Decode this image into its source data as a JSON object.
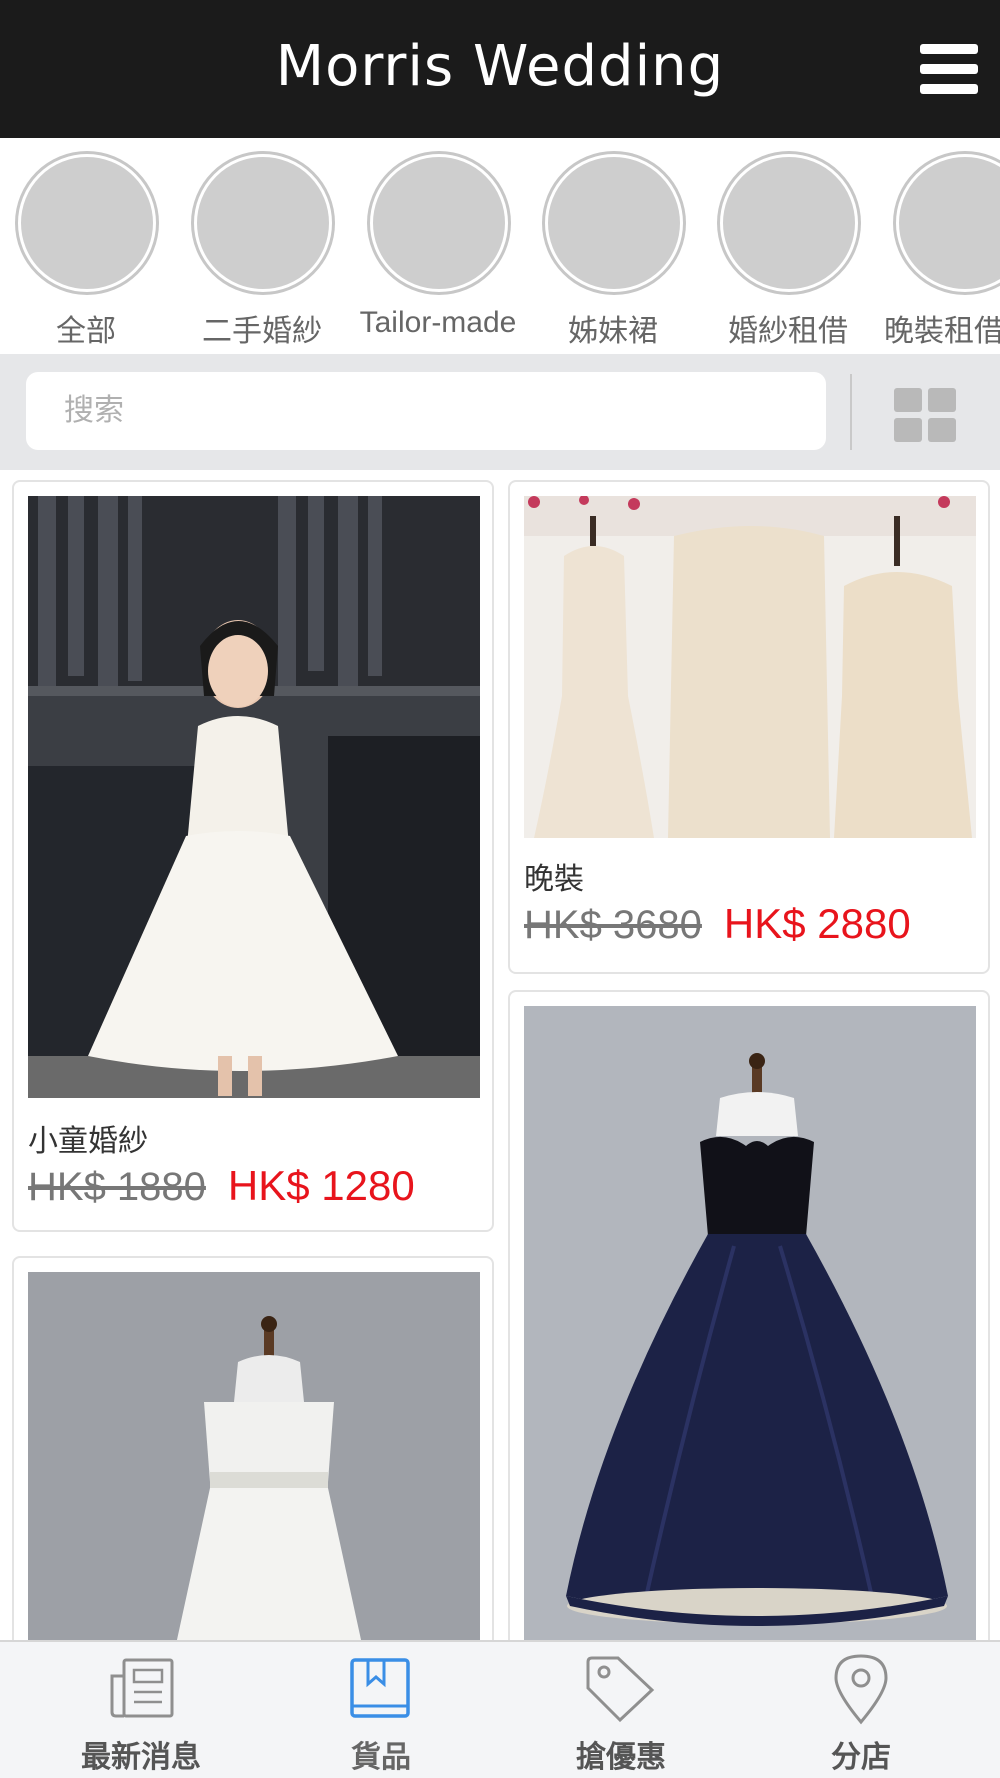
{
  "header": {
    "title": "Morris Wedding"
  },
  "categories": [
    {
      "label": "全部"
    },
    {
      "label": "二手婚紗"
    },
    {
      "label": "Tailor-made"
    },
    {
      "label": "姊妹裙"
    },
    {
      "label": "婚紗租借"
    },
    {
      "label": "晚裝租借"
    }
  ],
  "search": {
    "placeholder": "搜索",
    "value": ""
  },
  "products": [
    {
      "title": "小童婚紗",
      "old_price": "HK$ 1880",
      "new_price": "HK$ 1280"
    },
    {
      "title": "晚裝",
      "old_price": "HK$ 3680",
      "new_price": "HK$ 2880"
    },
    {
      "title": "",
      "old_price": "",
      "new_price": ""
    },
    {
      "title": "",
      "old_price": "",
      "new_price": ""
    }
  ],
  "tabbar": {
    "active_index": 1,
    "active_color": "#3a8ee6",
    "items": [
      {
        "label": "最新消息",
        "icon": "newspaper-icon"
      },
      {
        "label": "貨品",
        "icon": "book-icon"
      },
      {
        "label": "搶優惠",
        "icon": "tag-icon"
      },
      {
        "label": "分店",
        "icon": "location-pin-icon"
      }
    ]
  },
  "colors": {
    "header_bg": "#1b1b1b",
    "price_sale": "#e8141c",
    "price_original": "#777777"
  }
}
